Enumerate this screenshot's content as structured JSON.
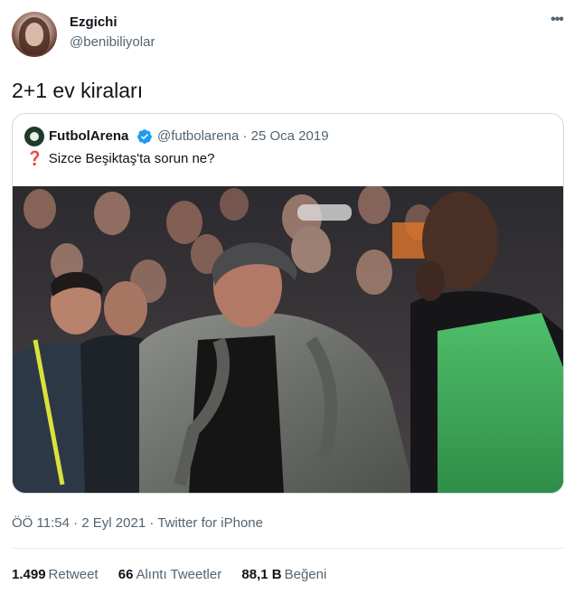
{
  "tweet": {
    "author": {
      "name": "Ezgichi",
      "handle": "@benibiliyolar"
    },
    "more_icon": "more-horizontal-icon",
    "text": "2+1 ev kiraları",
    "quoted": {
      "name": "FutbolArena",
      "handle": "@futbolarena",
      "separator": "·",
      "date": "25 Oca 2019",
      "emoji": "❓",
      "text": "Sizce Beşiktaş'ta sorun ne?",
      "verified_icon": "verified-badge-icon",
      "photo_alt": "football coach on sideline"
    },
    "meta": {
      "time": "ÖÖ 11:54",
      "sep1": "·",
      "date": "2 Eyl 2021",
      "sep2": "·",
      "source": "Twitter for iPhone"
    },
    "stats": {
      "retweets_count": "1.499",
      "retweets_label": "Retweet",
      "quotes_count": "66",
      "quotes_label": "Alıntı Tweetler",
      "likes_count": "88,1 B",
      "likes_label": "Beğeni"
    }
  },
  "colors": {
    "text": "#0f1419",
    "secondary": "#536471",
    "verified": "#1d9bf0",
    "border": "#cfd9de"
  }
}
